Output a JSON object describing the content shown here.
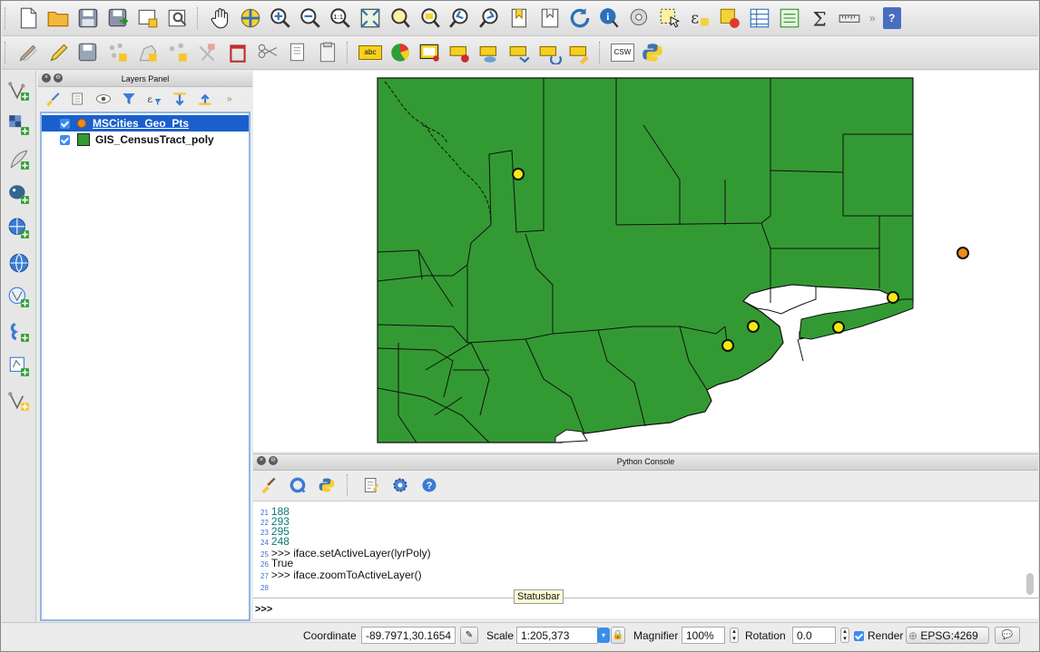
{
  "colors": {
    "polygon_fill": "#339a33",
    "selection": "#1a5fcc",
    "city_point_yellow": "#f5ea10",
    "city_point_orange": "#f08a18",
    "accent": "#3a8eea"
  },
  "toolbar_top": {
    "icons": [
      "new-project-icon",
      "open-project-icon",
      "save-project-icon",
      "save-as-icon",
      "new-print-composer-icon",
      "composer-manager-icon",
      "pan-hand-icon",
      "pan-to-selection-icon",
      "zoom-in-icon",
      "zoom-out-icon",
      "zoom-native-icon",
      "zoom-full-icon",
      "zoom-to-selection-icon",
      "zoom-to-layer-icon",
      "zoom-last-icon",
      "zoom-next-icon",
      "new-bookmark-icon",
      "show-bookmarks-icon",
      "refresh-icon",
      "identify-icon",
      "run-action-icon",
      "select-features-icon",
      "select-by-expression-icon",
      "deselect-icon",
      "attribute-table-icon",
      "field-calculator-icon",
      "statistical-summary-icon",
      "measure-icon",
      "overflow-icon",
      "help-icon"
    ],
    "help_label": "?",
    "overflow_label": "»"
  },
  "toolbar_second": {
    "icons": [
      "current-edits-icon",
      "toggle-editing-icon",
      "save-edits-icon",
      "add-feature-icon",
      "move-feature-icon",
      "node-tool-icon",
      "delete-selected-icon",
      "cut-features-icon",
      "copy-features-icon",
      "paste-features-icon",
      "label-tool-icon",
      "diagram-icon",
      "layer-labeling-icon",
      "pin-labels-icon",
      "show-hide-labels-icon",
      "move-label-icon",
      "rotate-label-icon",
      "change-label-icon",
      "csw-icon",
      "python-console-icon"
    ],
    "label_abc": "abc",
    "csw_label": "CSW"
  },
  "left_toolbar": {
    "icons": [
      "add-vector-layer-icon",
      "add-raster-layer-icon",
      "add-delimited-text-icon",
      "add-postgis-layer-icon",
      "add-spatialite-layer-icon",
      "add-wms-layer-icon",
      "add-wfs-layer-icon",
      "add-virtual-layer-icon",
      "new-shapefile-icon",
      "new-spatialite-layer-icon"
    ]
  },
  "layers_panel": {
    "title": "Layers Panel",
    "tool_icons": [
      "style-manager-icon",
      "add-group-icon",
      "manage-visibility-icon",
      "filter-legend-icon",
      "filter-expression-icon",
      "expand-all-icon",
      "collapse-all-icon",
      "remove-layer-icon"
    ],
    "layers": [
      {
        "name": "MSCities_Geo_Pts",
        "checked": true,
        "selected": true,
        "symbol": "point"
      },
      {
        "name": "GIS_CensusTract_poly",
        "checked": true,
        "selected": false,
        "symbol": "polygon"
      }
    ]
  },
  "python_console": {
    "title": "Python Console",
    "tool_icons": [
      "clear-console-icon",
      "console-settings-icon",
      "python-icon",
      "editor-icon",
      "options-gear-icon",
      "help-icon"
    ],
    "lines": [
      {
        "num": "21",
        "text": "188",
        "kind": "value"
      },
      {
        "num": "22",
        "text": "293",
        "kind": "value"
      },
      {
        "num": "23",
        "text": "295",
        "kind": "value"
      },
      {
        "num": "24",
        "text": "248",
        "kind": "value"
      },
      {
        "num": "25",
        "text": ">>> iface.setActiveLayer(lyrPoly)",
        "kind": "code"
      },
      {
        "num": "26",
        "text": "True",
        "kind": "code"
      },
      {
        "num": "27",
        "text": ">>> iface.zoomToActiveLayer()",
        "kind": "code"
      },
      {
        "num": "28",
        "text": "",
        "kind": "code"
      }
    ],
    "prompt": ">>>",
    "tooltip": "Statusbar"
  },
  "statusbar": {
    "coordinate_label": "Coordinate",
    "coordinate_value": "-89.7971,30.1654",
    "scale_label": "Scale",
    "scale_value": "1:205,373",
    "magnifier_label": "Magnifier",
    "magnifier_value": "100%",
    "rotation_label": "Rotation",
    "rotation_value": "0.0",
    "render_label": "Render",
    "render_checked": true,
    "crs_label": "EPSG:4269"
  }
}
